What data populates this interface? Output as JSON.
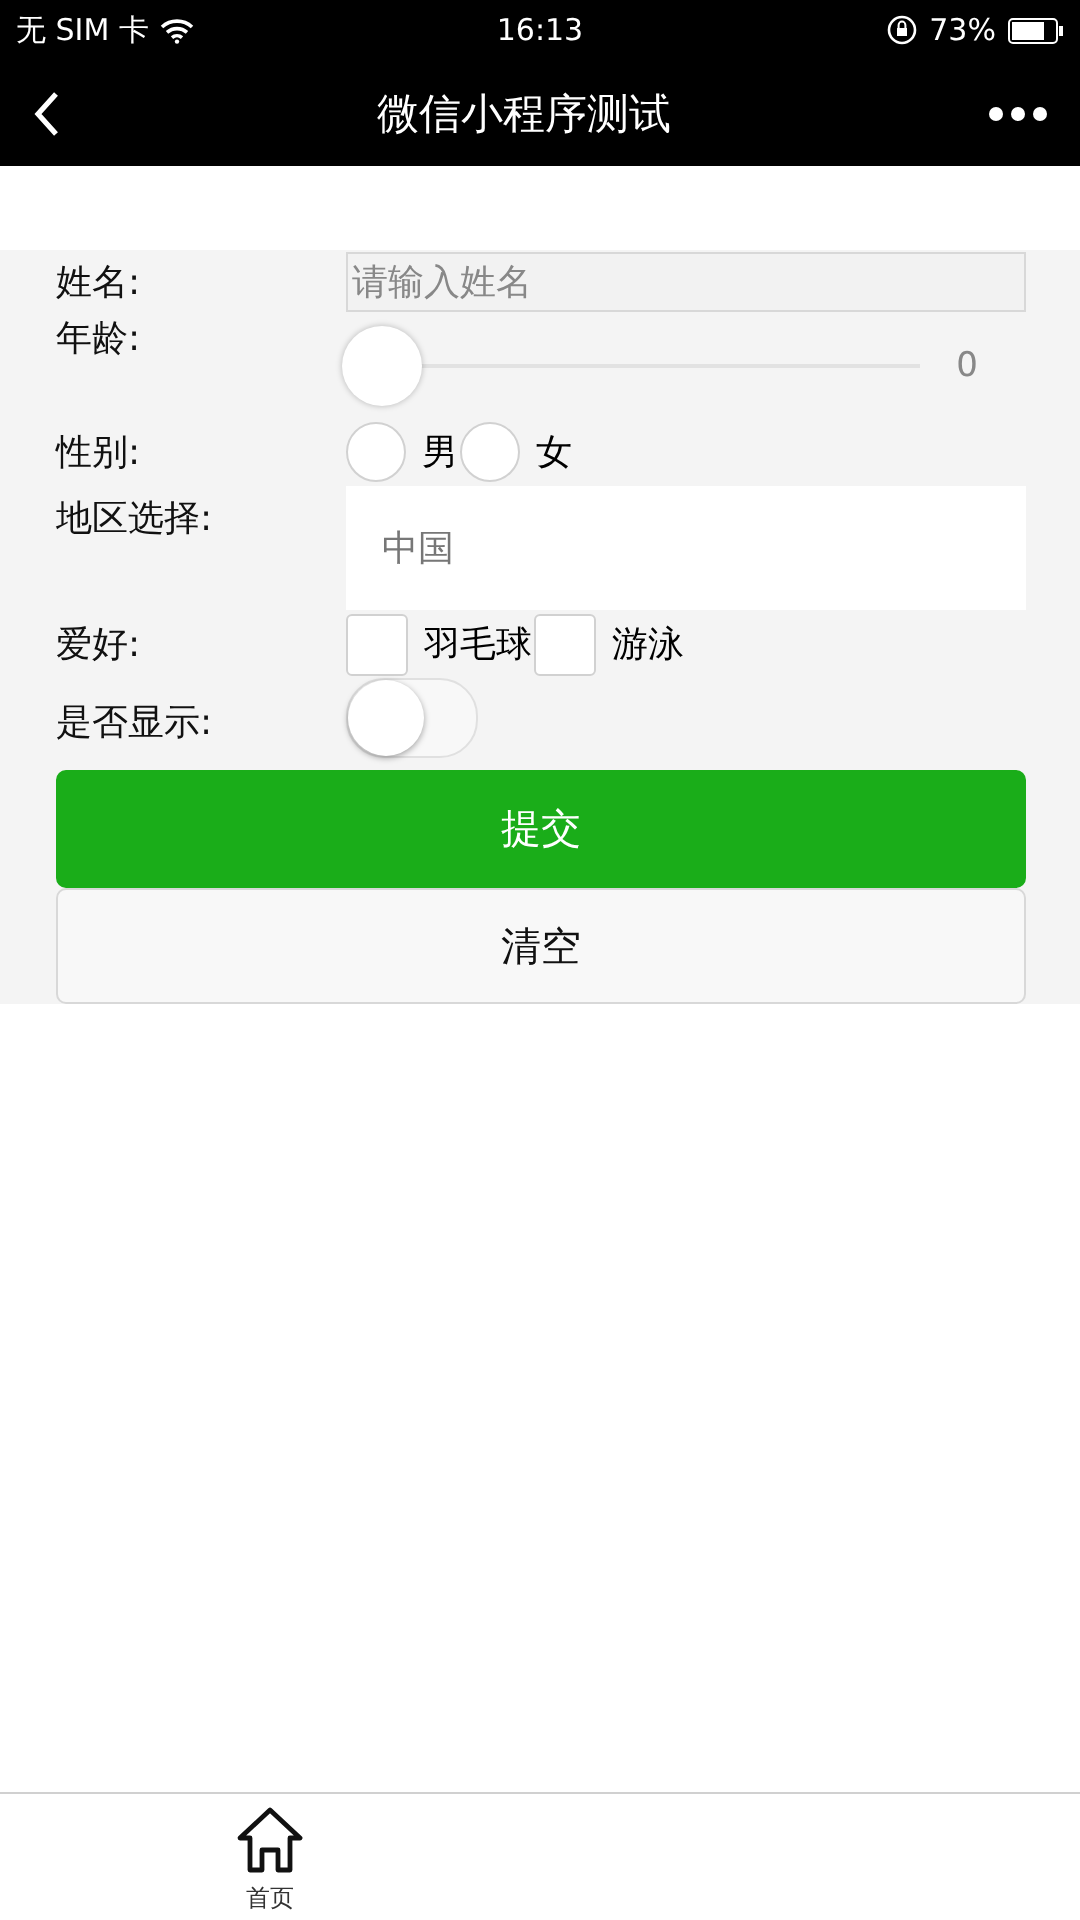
{
  "status_bar": {
    "carrier": "无 SIM 卡",
    "time": "16:13",
    "battery": "73%"
  },
  "nav_bar": {
    "title": "微信小程序测试"
  },
  "form": {
    "fields": [
      {
        "kind": "text",
        "label": "姓名:",
        "placeholder": "请输入姓名"
      },
      {
        "kind": "slider",
        "label": "年龄:",
        "level": 0,
        "reading": "0"
      },
      {
        "kind": "radio",
        "label": "性别:",
        "options": [
          {
            "label": "男",
            "selected": false
          },
          {
            "label": "女",
            "selected": false
          }
        ]
      },
      {
        "kind": "picker",
        "label": "地区选择:",
        "value": "中国"
      },
      {
        "kind": "checkbox",
        "label": "爱好:",
        "options": [
          {
            "label": "羽毛球",
            "checked": false
          },
          {
            "label": "游泳",
            "checked": false
          }
        ]
      },
      {
        "kind": "switch",
        "label": "是否显示:",
        "on": false
      }
    ],
    "buttons": [
      {
        "kind": "primary",
        "label": "提交"
      },
      {
        "kind": "default",
        "label": "清空"
      }
    ]
  },
  "tab_bar": {
    "items": [
      {
        "label": "首页",
        "selected": true
      }
    ]
  }
}
